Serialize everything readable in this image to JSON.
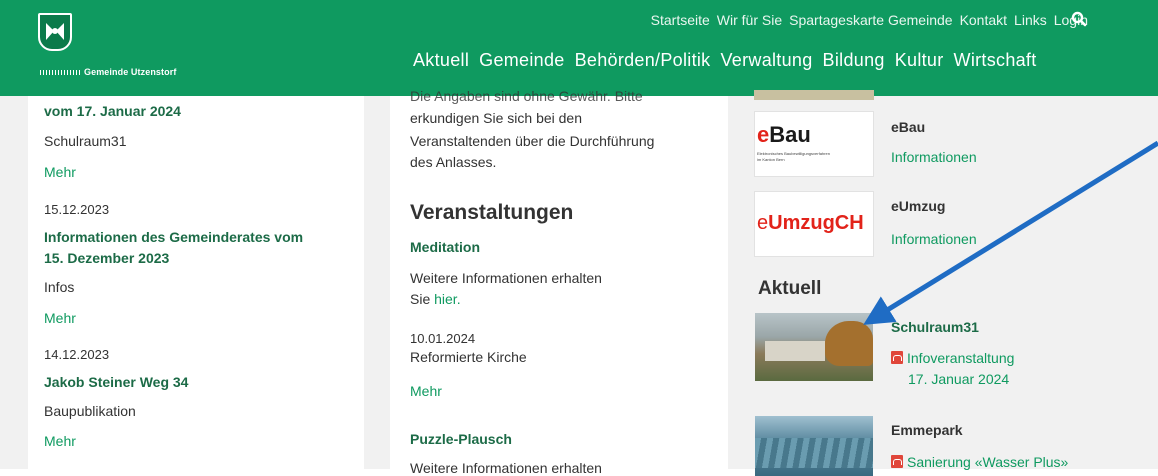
{
  "header": {
    "logo_text": "Gemeinde Utzenstorf",
    "top_links": [
      "Startseite",
      "Wir für Sie",
      "Spartageskarte Gemeinde",
      "Kontakt",
      "Links",
      "Login"
    ],
    "main_nav": [
      "Aktuell",
      "Gemeinde",
      "Behörden/Politik",
      "Verwaltung",
      "Bildung",
      "Kultur",
      "Wirtschaft"
    ]
  },
  "news": {
    "item1": {
      "title_line": "vom 17. Januar 2024",
      "type": "Schulraum31",
      "more": "Mehr"
    },
    "item2": {
      "date": "15.12.2023",
      "title_l1": "Informationen des Gemeinderates vom",
      "title_l2": "15. Dezember 2023",
      "type": "Infos",
      "more": "Mehr"
    },
    "item3": {
      "date": "14.12.2023",
      "title": "Jakob Steiner Weg 34",
      "type": "Baupublikation",
      "more": "Mehr"
    }
  },
  "middle": {
    "notice_l1": "Die Angaben sind ohne Gewähr. Bitte",
    "notice_l2": "erkundigen Sie sich bei den",
    "notice_l3": "Veranstaltenden über die Durchführung",
    "notice_l4": "des Anlasses.",
    "heading": "Veranstaltungen",
    "event1": {
      "title": "Meditation",
      "info": "Weitere Informationen erhalten",
      "info2_prefix": "Sie ",
      "info2_link": "hier.",
      "date": "10.01.2024",
      "place": "Reformierte Kirche",
      "more": "Mehr"
    },
    "event2": {
      "title": "Puzzle-Plausch",
      "info": "Weitere Informationen erhalten"
    }
  },
  "right": {
    "ebau": {
      "logo": "eBau",
      "logo_sub1": "Elektronisches Baubewilligungsverfahren",
      "logo_sub2": "im Kanton Bern",
      "title": "eBau",
      "link": "Informationen"
    },
    "eumzug": {
      "logo": "eUmzugCH",
      "title": "eUmzug",
      "link": "Informationen"
    },
    "aktuell_heading": "Aktuell",
    "schulraum": {
      "title": "Schulraum31",
      "link": "Infoveranstaltung",
      "date": "17. Januar 2024"
    },
    "emmepark": {
      "title": "Emmepark",
      "link": "Sanierung «Wasser Plus»"
    }
  },
  "colors": {
    "brand_green": "#0f9a60",
    "dark_green": "#1c6b47",
    "arrow_blue": "#1f6cc4",
    "pdf_red": "#e0463a",
    "ebau_red": "#e2231a"
  }
}
